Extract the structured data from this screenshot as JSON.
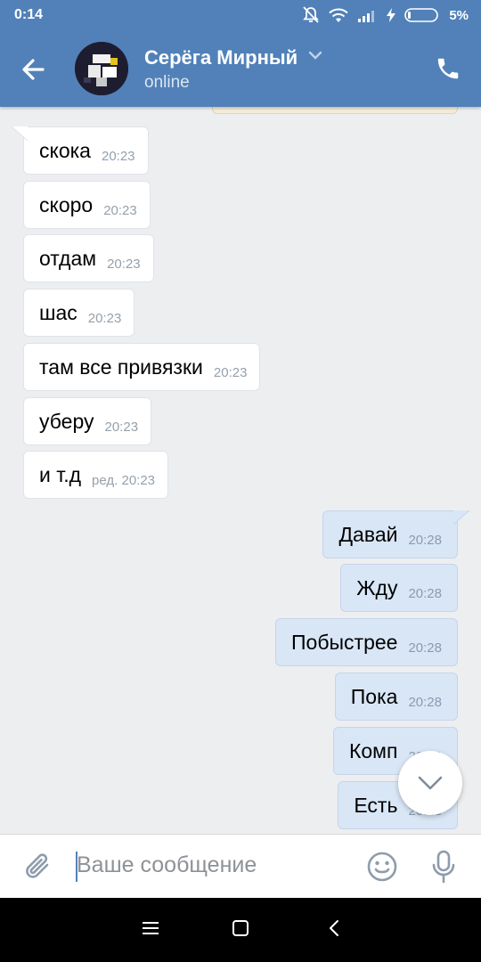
{
  "status_bar": {
    "time": "0:14",
    "battery": "5%"
  },
  "header": {
    "contact_name": "Серёга Мирный",
    "contact_status": "online",
    "icons": [
      "back-arrow-icon",
      "chevron-down-icon",
      "phone-icon"
    ]
  },
  "messages": [
    {
      "direction": "in",
      "text": "скока",
      "time": "20:23"
    },
    {
      "direction": "in",
      "text": "скоро",
      "time": "20:23"
    },
    {
      "direction": "in",
      "text": "отдам",
      "time": "20:23"
    },
    {
      "direction": "in",
      "text": "шас",
      "time": "20:23"
    },
    {
      "direction": "in",
      "text": "там все привязки",
      "time": "20:23"
    },
    {
      "direction": "in",
      "text": "уберу",
      "time": "20:23"
    },
    {
      "direction": "in",
      "text": "и т.д",
      "time": "ред. 20:23"
    },
    {
      "direction": "out",
      "text": "Давай",
      "time": "20:28"
    },
    {
      "direction": "out",
      "text": "Жду",
      "time": "20:28"
    },
    {
      "direction": "out",
      "text": "Побыстрее",
      "time": "20:28"
    },
    {
      "direction": "out",
      "text": "Пока",
      "time": "20:28"
    },
    {
      "direction": "out",
      "text": "Комп",
      "time": "20:28"
    },
    {
      "direction": "out",
      "text": "Есть",
      "time": "20:28"
    }
  ],
  "composer": {
    "placeholder": "Ваше сообщение",
    "icons": [
      "paperclip-icon",
      "emoji-icon",
      "microphone-icon"
    ]
  },
  "colors": {
    "header": "#5181b8",
    "background": "#edeef0",
    "incoming_bubble": "#ffffff",
    "outgoing_bubble": "#d9e6f6"
  }
}
